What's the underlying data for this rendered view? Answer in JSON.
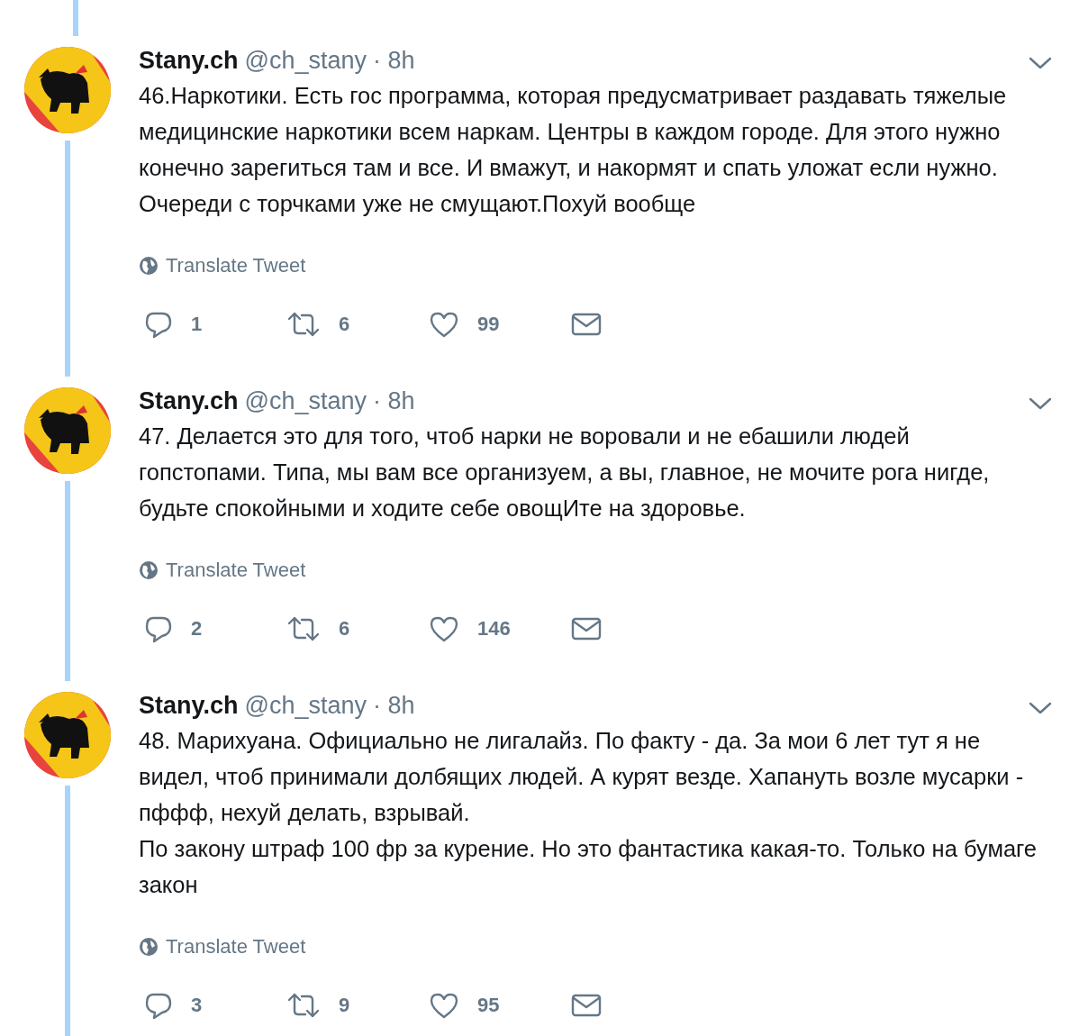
{
  "tweets": [
    {
      "name": "Stany.ch",
      "handle": "@ch_stany",
      "time": "· 8h",
      "text": "46.Наркотики. Есть гос программа, которая предусматривает раздавать тяжелые медицинские наркотики всем наркам. Центры в каждом городе. Для этого нужно конечно зарегиться там и все. И вмажут, и накормят и спать уложат если нужно. Очереди с торчками уже не смущают.Похуй вообще",
      "translate": "Translate Tweet",
      "replies": "1",
      "retweets": "6",
      "likes": "99"
    },
    {
      "name": "Stany.ch",
      "handle": "@ch_stany",
      "time": "· 8h",
      "text": "47. Делается это для того, чтоб нарки не воровали и не ебашили людей гопстопами. Типа, мы вам все организуем, а вы, главное, не мочите рога нигде, будьте спокойными и ходите себе овощИте на здоровье.",
      "translate": "Translate Tweet",
      "replies": "2",
      "retweets": "6",
      "likes": "146"
    },
    {
      "name": "Stany.ch",
      "handle": "@ch_stany",
      "time": "· 8h",
      "text": "48. Марихуана. Официально не лигалайз. По факту - да. За мои 6 лет тут я не видел, чтоб принимали долбящих людей. А курят везде. Хапануть возле мусарки - пффф, нехуй делать, взрывай.\nПо закону штраф 100 фр за курение. Но это фантастика какая-то. Только на бумаге закон",
      "translate": "Translate Tweet",
      "replies": "3",
      "retweets": "9",
      "likes": "95"
    }
  ]
}
